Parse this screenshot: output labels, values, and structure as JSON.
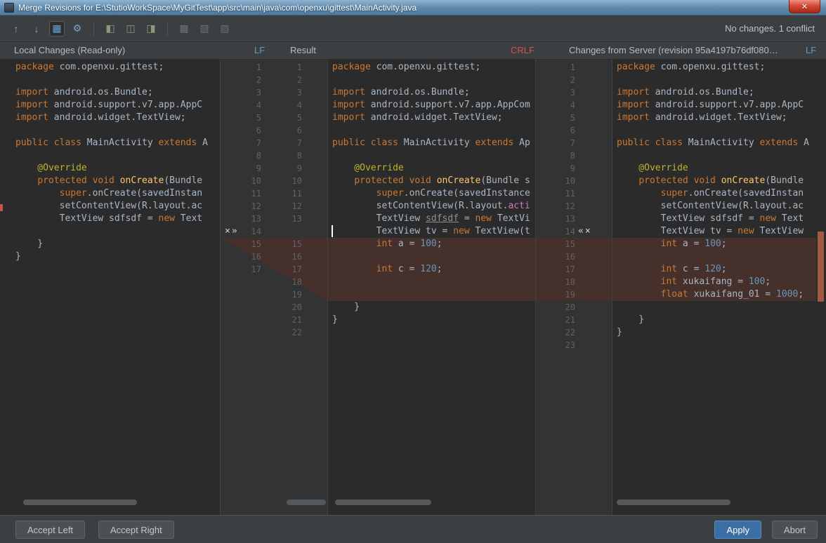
{
  "window": {
    "title": "Merge Revisions for E:\\StutioWorkSpace\\MyGitTest\\app\\src\\main\\java\\com\\openxu\\gittest\\MainActivity.java",
    "close_glyph": "✕"
  },
  "toolbar": {
    "status": "No changes. 1 conflict",
    "icons": [
      {
        "type": "icon",
        "name": "previous-difference-icon",
        "glyph": "↑"
      },
      {
        "type": "icon",
        "name": "next-difference-icon",
        "glyph": "↓"
      },
      {
        "type": "icon",
        "name": "side-by-side-viewer-icon",
        "glyph": "▦",
        "active": true,
        "tint": "#6ea1d1"
      },
      {
        "type": "icon",
        "name": "settings-gear-icon",
        "glyph": "⚙",
        "tint": "#7ba3cc"
      },
      {
        "type": "sep"
      },
      {
        "type": "icon",
        "name": "apply-non-conflicting-left-icon",
        "glyph": "◧",
        "tint": "#8a9a7b"
      },
      {
        "type": "icon",
        "name": "apply-all-non-conflicting-icon",
        "glyph": "◫",
        "tint": "#8a9a7b"
      },
      {
        "type": "icon",
        "name": "apply-non-conflicting-right-icon",
        "glyph": "◨",
        "tint": "#8a9a7b"
      },
      {
        "type": "sep"
      },
      {
        "type": "icon",
        "name": "compare-mode-1-icon",
        "glyph": "▩",
        "tint": "#6d7072"
      },
      {
        "type": "icon",
        "name": "compare-mode-2-icon",
        "glyph": "▨",
        "tint": "#6d7072"
      },
      {
        "type": "icon",
        "name": "compare-mode-3-icon",
        "glyph": "▧",
        "tint": "#6d7072"
      }
    ]
  },
  "headers": {
    "left": "Local Changes (Read-only)",
    "left_eol": "LF",
    "middle": "Result",
    "middle_eol": "CRLF",
    "right": "Changes from Server (revision 95a4197b76df080…",
    "right_eol": "LF"
  },
  "markers": {
    "left_gutter": {
      "row": 14,
      "glyphs": "×»"
    },
    "right_gutter": {
      "row": 14,
      "glyphs": "«×"
    }
  },
  "conflict": {
    "middle_rows": [
      15,
      19
    ],
    "right_rows": [
      15,
      19
    ]
  },
  "buttons": {
    "accept_left": "Accept Left",
    "accept_right": "Accept Right",
    "apply": "Apply",
    "abort": "Abort"
  },
  "colors": {
    "keyword": "#CC7832",
    "number": "#6897BB",
    "annotation": "#BBB529",
    "conflict_bg": "#45302B",
    "eol_lf": "#6897BB",
    "eol_crlf": "#D25252",
    "apply_button": "#3A6EA5"
  },
  "panels": {
    "left": {
      "lines": [
        [
          [
            "package",
            "k"
          ],
          [
            " com.openxu.gittest;",
            "p"
          ]
        ],
        [],
        [
          [
            "import",
            "k"
          ],
          [
            " android.os.Bundle;",
            "p"
          ]
        ],
        [
          [
            "import",
            "k"
          ],
          [
            " android.support.v7.app.AppC",
            "p"
          ]
        ],
        [
          [
            "import",
            "k"
          ],
          [
            " android.widget.TextView;",
            "p"
          ]
        ],
        [],
        [
          [
            "public class",
            "k"
          ],
          [
            " MainActivity ",
            "p"
          ],
          [
            "extends",
            "k"
          ],
          [
            " A",
            "p"
          ]
        ],
        [],
        [
          [
            "    @Override",
            "a"
          ]
        ],
        [
          [
            "    ",
            "p"
          ],
          [
            "protected void",
            "k"
          ],
          [
            " ",
            "p"
          ],
          [
            "onCreate",
            "m"
          ],
          [
            "(Bundle",
            "p"
          ]
        ],
        [
          [
            "        ",
            "p"
          ],
          [
            "super",
            "k"
          ],
          [
            ".onCreate(savedInstan",
            "p"
          ]
        ],
        [
          [
            "        setContentView(R.layout.ac",
            "p"
          ]
        ],
        [
          [
            "        TextView sdfsdf = ",
            "p"
          ],
          [
            "new",
            "k"
          ],
          [
            " Text",
            "p"
          ]
        ],
        [],
        [
          [
            "    }",
            "p"
          ]
        ],
        [
          [
            "}",
            "p"
          ]
        ],
        []
      ]
    },
    "middle": {
      "cursor_row": 14,
      "lines": [
        [
          [
            "package",
            "k"
          ],
          [
            " com.openxu.gittest;",
            "p"
          ]
        ],
        [],
        [
          [
            "import",
            "k"
          ],
          [
            " android.os.Bundle;",
            "p"
          ]
        ],
        [
          [
            "import",
            "k"
          ],
          [
            " android.support.v7.app.AppCom",
            "p"
          ]
        ],
        [
          [
            "import",
            "k"
          ],
          [
            " android.widget.TextView;",
            "p"
          ]
        ],
        [],
        [
          [
            "public class",
            "k"
          ],
          [
            " MainActivity ",
            "p"
          ],
          [
            "extends",
            "k"
          ],
          [
            " Ap",
            "p"
          ]
        ],
        [],
        [
          [
            "    @Override",
            "a"
          ]
        ],
        [
          [
            "    ",
            "p"
          ],
          [
            "protected void",
            "k"
          ],
          [
            " ",
            "p"
          ],
          [
            "onCreate",
            "m"
          ],
          [
            "(Bundle s",
            "p"
          ]
        ],
        [
          [
            "        ",
            "p"
          ],
          [
            "super",
            "k"
          ],
          [
            ".onCreate(savedInstance",
            "p"
          ]
        ],
        [
          [
            "        setContentView(R.layout.",
            "p"
          ],
          [
            "acti",
            "pk"
          ]
        ],
        [
          [
            "        TextView ",
            "p"
          ],
          [
            "sdfsdf",
            "g"
          ],
          [
            " = ",
            "p"
          ],
          [
            "new",
            "k"
          ],
          [
            " TextVi",
            "p"
          ]
        ],
        [
          [
            "        TextView tv = ",
            "p"
          ],
          [
            "new",
            "k"
          ],
          [
            " TextView(t",
            "p"
          ]
        ],
        [
          [
            "        ",
            "p"
          ],
          [
            "int",
            "k"
          ],
          [
            " a = ",
            "p"
          ],
          [
            "100",
            "n"
          ],
          [
            ";",
            "p"
          ]
        ],
        [],
        [
          [
            "        ",
            "p"
          ],
          [
            "int",
            "k"
          ],
          [
            " c = ",
            "p"
          ],
          [
            "120",
            "n"
          ],
          [
            ";",
            "p"
          ]
        ],
        [],
        [],
        [
          [
            "    }",
            "p"
          ]
        ],
        [
          [
            "}",
            "p"
          ]
        ],
        []
      ]
    },
    "right": {
      "lines": [
        [
          [
            "package",
            "k"
          ],
          [
            " com.openxu.gittest;",
            "p"
          ]
        ],
        [],
        [
          [
            "import",
            "k"
          ],
          [
            " android.os.Bundle;",
            "p"
          ]
        ],
        [
          [
            "import",
            "k"
          ],
          [
            " android.support.v7.app.AppC",
            "p"
          ]
        ],
        [
          [
            "import",
            "k"
          ],
          [
            " android.widget.TextView;",
            "p"
          ]
        ],
        [],
        [
          [
            "public class",
            "k"
          ],
          [
            " MainActivity ",
            "p"
          ],
          [
            "extends",
            "k"
          ],
          [
            " A",
            "p"
          ]
        ],
        [],
        [
          [
            "    @Override",
            "a"
          ]
        ],
        [
          [
            "    ",
            "p"
          ],
          [
            "protected void",
            "k"
          ],
          [
            " ",
            "p"
          ],
          [
            "onCreate",
            "m"
          ],
          [
            "(Bundle",
            "p"
          ]
        ],
        [
          [
            "        ",
            "p"
          ],
          [
            "super",
            "k"
          ],
          [
            ".onCreate(savedInstan",
            "p"
          ]
        ],
        [
          [
            "        setContentView(R.layout.ac",
            "p"
          ]
        ],
        [
          [
            "        TextView sdfsdf = ",
            "p"
          ],
          [
            "new",
            "k"
          ],
          [
            " Text",
            "p"
          ]
        ],
        [
          [
            "        TextView tv = ",
            "p"
          ],
          [
            "new",
            "k"
          ],
          [
            " TextView",
            "p"
          ]
        ],
        [
          [
            "        ",
            "p"
          ],
          [
            "int",
            "k"
          ],
          [
            " a = ",
            "p"
          ],
          [
            "100",
            "n"
          ],
          [
            ";",
            "p"
          ]
        ],
        [],
        [
          [
            "        ",
            "p"
          ],
          [
            "int",
            "k"
          ],
          [
            " c = ",
            "p"
          ],
          [
            "120",
            "n"
          ],
          [
            ";",
            "p"
          ]
        ],
        [
          [
            "        ",
            "p"
          ],
          [
            "int",
            "k"
          ],
          [
            " xukaifang = ",
            "p"
          ],
          [
            "100",
            "n"
          ],
          [
            ";",
            "p"
          ]
        ],
        [
          [
            "        ",
            "p"
          ],
          [
            "float",
            "k"
          ],
          [
            " xukaifang_01 = ",
            "p"
          ],
          [
            "1000",
            "n"
          ],
          [
            ";",
            "p"
          ]
        ],
        [],
        [
          [
            "    }",
            "p"
          ]
        ],
        [
          [
            "}",
            "p"
          ]
        ],
        []
      ]
    }
  }
}
